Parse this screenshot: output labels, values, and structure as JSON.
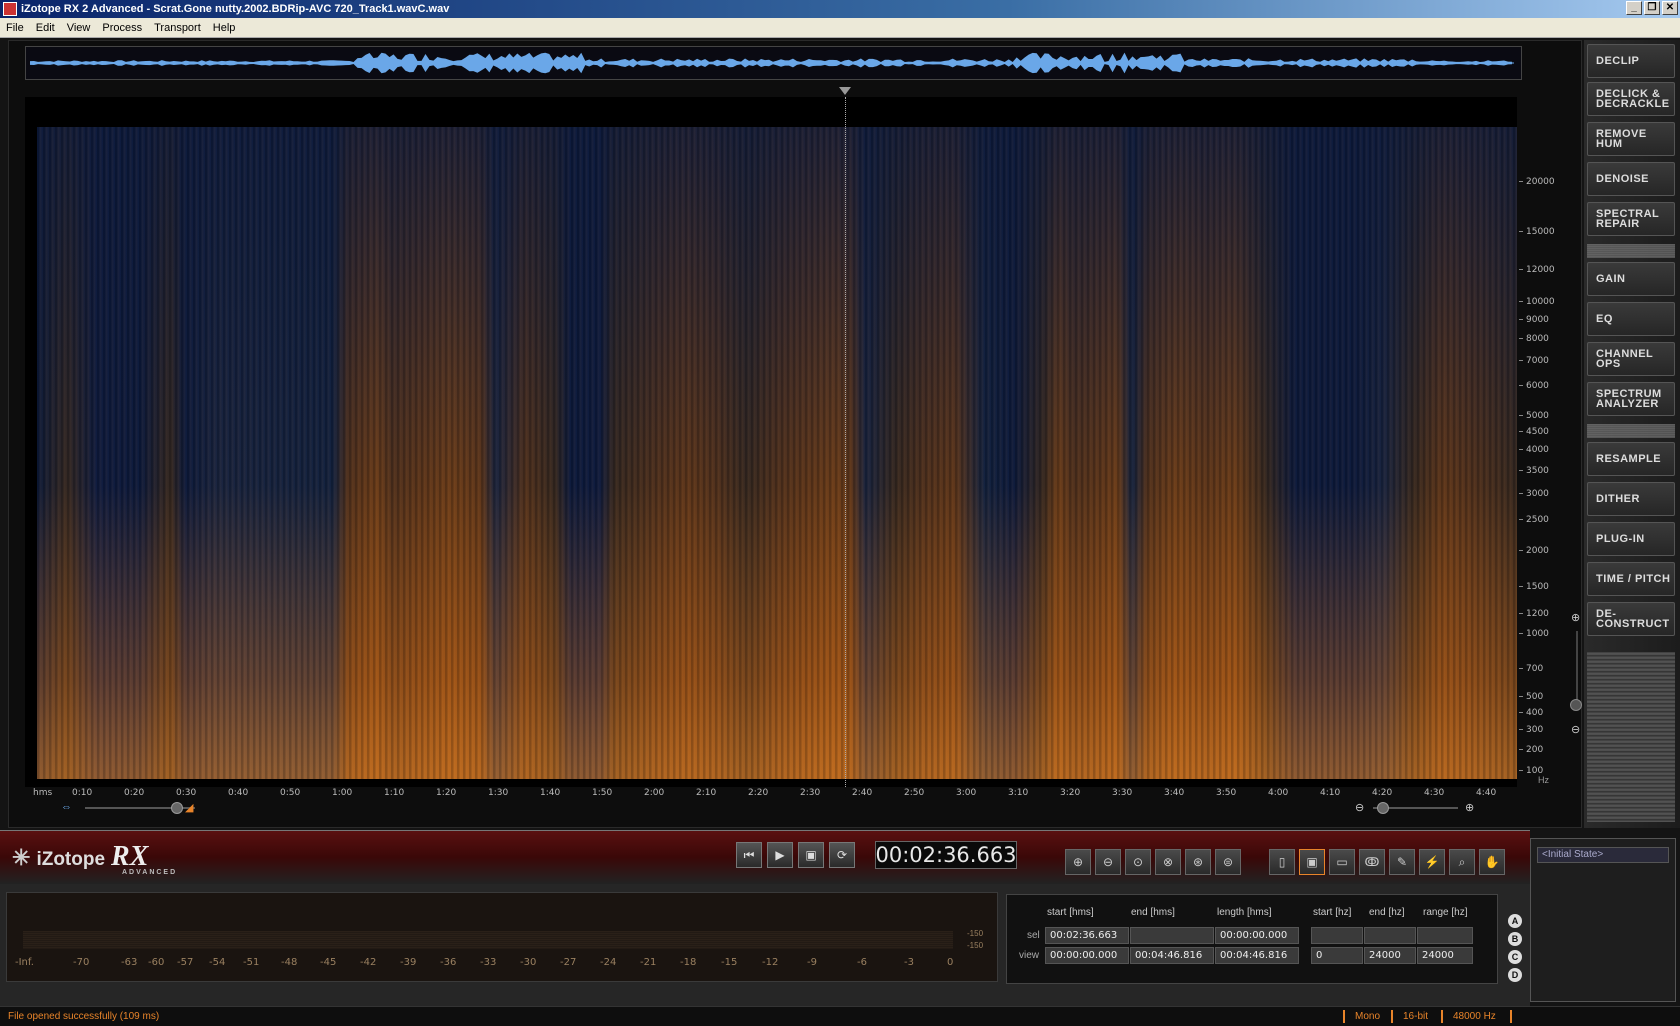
{
  "window": {
    "title": "iZotope RX 2 Advanced - Scrat.Gone nutty.2002.BDRip-AVC 720_Track1.wavC.wav"
  },
  "menu": [
    "File",
    "Edit",
    "View",
    "Process",
    "Transport",
    "Help"
  ],
  "spectrogram": {
    "freq_ticks": [
      "20000",
      "15000",
      "12000",
      "10000",
      "9000",
      "8000",
      "7000",
      "6000",
      "5000",
      "4500",
      "4000",
      "3500",
      "3000",
      "2500",
      "2000",
      "1500",
      "1200",
      "1000",
      "700",
      "500",
      "400",
      "300",
      "200",
      "100"
    ],
    "freq_unit": "Hz",
    "time_ticks": [
      "hms",
      "0:10",
      "0:20",
      "0:30",
      "0:40",
      "0:50",
      "1:00",
      "1:10",
      "1:20",
      "1:30",
      "1:40",
      "1:50",
      "2:00",
      "2:10",
      "2:20",
      "2:30",
      "2:40",
      "2:50",
      "3:00",
      "3:10",
      "3:20",
      "3:30",
      "3:40",
      "3:50",
      "4:00",
      "4:10",
      "4:20",
      "4:30",
      "4:40"
    ]
  },
  "modules": [
    "DECLIP",
    "DECLICK & DECRACKLE",
    "REMOVE HUM",
    "DENOISE",
    "SPECTRAL REPAIR",
    "GAIN",
    "EQ",
    "CHANNEL OPS",
    "SPECTRUM ANALYZER",
    "RESAMPLE",
    "DITHER",
    "PLUG-IN",
    "TIME / PITCH",
    "DE-CONSTRUCT"
  ],
  "logo": {
    "brand": "iZotope",
    "product": "RX",
    "edition": "ADVANCED"
  },
  "transport": {
    "timecode": "00:02:36.663",
    "buttons": [
      "skip-back-icon",
      "play-icon",
      "play-selection-icon",
      "loop-icon"
    ],
    "tools": [
      "zoom-in-icon",
      "zoom-out-icon",
      "zoom-selection-icon",
      "zoom-fit-icon",
      "zoom-time-icon",
      "zoom-freq-icon",
      "time-select-icon",
      "rect-select-icon",
      "freq-select-icon",
      "lasso-icon",
      "brush-icon",
      "wand-icon",
      "zoom-tool-icon",
      "hand-icon"
    ]
  },
  "meter": {
    "scale": [
      "-Inf.",
      "-70",
      "-63",
      "-60",
      "-57",
      "-54",
      "-51",
      "-48",
      "-45",
      "-42",
      "-39",
      "-36",
      "-33",
      "-30",
      "-27",
      "-24",
      "-21",
      "-18",
      "-15",
      "-12",
      "-9",
      "-6",
      "-3",
      "0"
    ],
    "right_labels": [
      "-150",
      "-150"
    ]
  },
  "selection": {
    "headers": [
      "start [hms]",
      "end [hms]",
      "length [hms]",
      "start [hz]",
      "end [hz]",
      "range [hz]"
    ],
    "rows": [
      {
        "label": "sel",
        "values": [
          "00:02:36.663",
          "",
          "00:00:00.000",
          "",
          "",
          ""
        ]
      },
      {
        "label": "view",
        "values": [
          "00:00:00.000",
          "00:04:46.816",
          "00:04:46.816",
          "0",
          "24000",
          "24000"
        ]
      }
    ],
    "snapshots": [
      "A",
      "B",
      "C",
      "D"
    ]
  },
  "history": {
    "items": [
      "<Initial State>"
    ]
  },
  "status": {
    "message": "File opened successfully (109 ms)",
    "channels": "Mono",
    "bitdepth": "16-bit",
    "samplerate": "48000 Hz"
  },
  "colors": {
    "accent": "#e8842a",
    "spectro_low": "#0c1a3d",
    "spectro_high": "#f28a2a",
    "waveform": "#6aa7e8"
  }
}
